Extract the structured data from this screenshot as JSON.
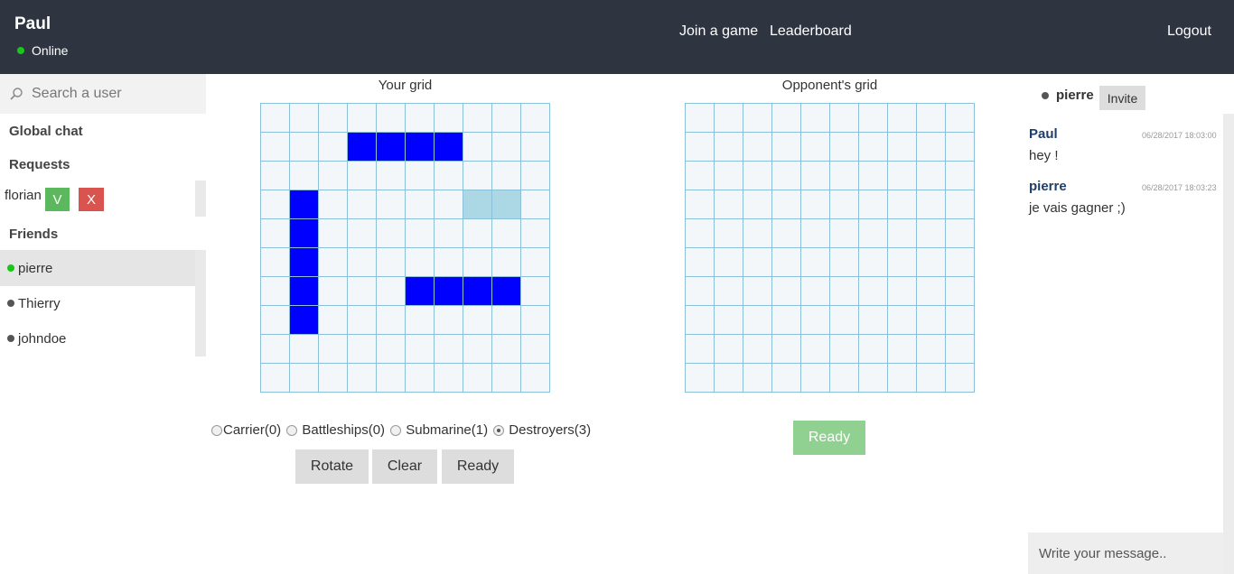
{
  "header": {
    "username": "Paul",
    "status": "Online",
    "nav": {
      "join": "Join a game",
      "leaderboard": "Leaderboard",
      "logout": "Logout"
    }
  },
  "sidebar": {
    "search_placeholder": "Search a user",
    "global_chat": "Global chat",
    "requests_heading": "Requests",
    "requests": [
      {
        "name": "florian",
        "accept": "V",
        "decline": "X"
      }
    ],
    "friends_heading": "Friends",
    "friends": [
      {
        "name": "pierre",
        "status": "online"
      },
      {
        "name": "Thierry",
        "status": "offline"
      },
      {
        "name": "johndoe",
        "status": "offline"
      }
    ]
  },
  "game": {
    "your_grid_title": "Your grid",
    "opponent_grid_title": "Opponent's grid",
    "grid_size": 10,
    "your_ships": [
      [
        1,
        3
      ],
      [
        1,
        4
      ],
      [
        1,
        5
      ],
      [
        1,
        6
      ],
      [
        3,
        1
      ],
      [
        4,
        1
      ],
      [
        5,
        1
      ],
      [
        6,
        1
      ],
      [
        7,
        1
      ],
      [
        6,
        5
      ],
      [
        6,
        6
      ],
      [
        6,
        7
      ],
      [
        6,
        8
      ]
    ],
    "your_preview": [
      [
        3,
        7
      ],
      [
        3,
        8
      ]
    ],
    "ship_options": [
      {
        "label": "Carrier(0)",
        "checked": false
      },
      {
        "label": "Battleships(0)",
        "checked": false
      },
      {
        "label": "Submarine(1)",
        "checked": false
      },
      {
        "label": "Destroyers(3)",
        "checked": true
      }
    ],
    "buttons": {
      "rotate": "Rotate",
      "clear": "Clear",
      "ready": "Ready"
    },
    "opponent_ready": "Ready"
  },
  "chat": {
    "peer": "pierre",
    "invite": "Invite",
    "messages": [
      {
        "author": "Paul",
        "time": "06/28/2017 18:03:00",
        "text": "hey !"
      },
      {
        "author": "pierre",
        "time": "06/28/2017 18:03:23",
        "text": "je vais gagner ;)"
      }
    ],
    "input_placeholder": "Write your message.."
  },
  "colors": {
    "header_bg": "#2e3440",
    "ship": "#0000ff",
    "preview": "#acd8e6",
    "online": "#1bc61b"
  }
}
